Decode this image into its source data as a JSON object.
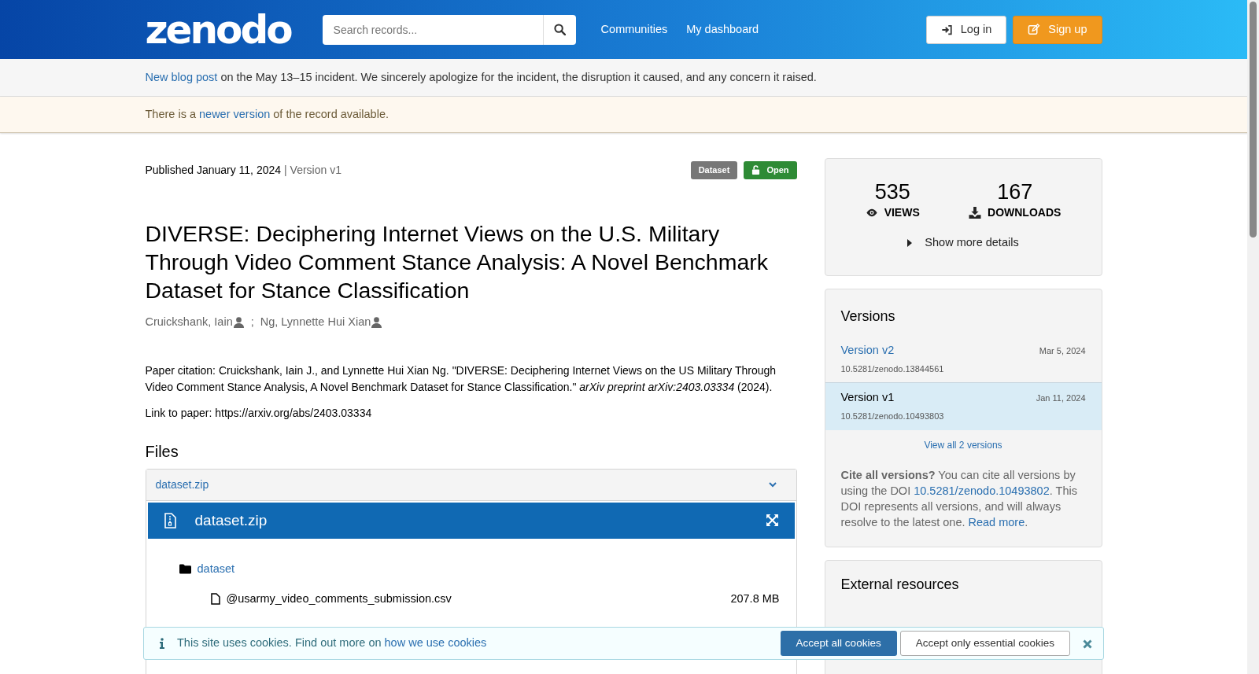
{
  "header": {
    "logo": "zenodo",
    "search": {
      "placeholder": "Search records..."
    },
    "nav": [
      "Communities",
      "My dashboard"
    ],
    "login": "Log in",
    "signup": "Sign up"
  },
  "notices": [
    {
      "kind": "blog",
      "parts": [
        {
          "kind": "link",
          "text": "New blog post"
        },
        {
          "kind": "text",
          "text": " on the May 13–15 incident. We sincerely apologize for the incident, the disruption it caused, and any concern it raised."
        }
      ]
    },
    {
      "kind": "warning",
      "parts": [
        {
          "kind": "text",
          "text": "There is a "
        },
        {
          "kind": "link",
          "text": "newer version"
        },
        {
          "kind": "text",
          "text": " of the record available."
        }
      ]
    }
  ],
  "record": {
    "published": "Published January 11, 2024",
    "version": "| Version v1",
    "badges": [
      {
        "kind": "type",
        "label": "Dataset"
      },
      {
        "kind": "access",
        "label": "Open"
      }
    ],
    "title": "DIVERSE: Deciphering Internet Views on the U.S. Military Through Video Comment Stance Analysis: A Novel Benchmark Dataset for Stance Classification",
    "creators": [
      "Cruickshank, Iain",
      "Ng, Lynnette Hui Xian"
    ],
    "creator_separator": ";",
    "description": [
      "Paper citation: Cruickshank, Iain J., and Lynnette Hui Xian Ng. \"DIVERSE: Deciphering Internet Views on the US Military Through Video Comment Stance Analysis, A Novel Benchmark Dataset for Stance Classification.\" *arXiv preprint arXiv:2403.03334* (2024).",
      "Link to paper: https://arxiv.org/abs/2403.03334"
    ]
  },
  "files": {
    "heading": "Files",
    "accordion": {
      "label": "dataset.zip",
      "expanded": true
    },
    "preview_title": "dataset.zip",
    "tree": [
      {
        "kind": "folder",
        "name": "dataset",
        "children": [
          {
            "kind": "file",
            "name": "@usarmy_video_comments_submission.csv",
            "size": "207.8 MB"
          }
        ]
      }
    ]
  },
  "stats": {
    "views": "535",
    "views_label": "VIEWS",
    "downloads": "167",
    "downloads_label": "DOWNLOADS",
    "more": "Show more details"
  },
  "versions": {
    "title": "Versions",
    "items": [
      {
        "label": "Version v2",
        "date": "Mar 5, 2024",
        "doi": "10.5281/zenodo.13844561",
        "selected": false
      },
      {
        "label": "Version v1",
        "date": "Jan 11, 2024",
        "doi": "10.5281/zenodo.10493803",
        "selected": true
      }
    ],
    "view_all": "View all 2 versions",
    "cite": [
      {
        "kind": "bold",
        "text": "Cite all versions?"
      },
      {
        "kind": "text",
        "text": " You can cite all versions by using the DOI "
      },
      {
        "kind": "link",
        "text": "10.5281/zenodo.10493802"
      },
      {
        "kind": "text",
        "text": ". This DOI represents all versions, and will always resolve to the latest one. "
      },
      {
        "kind": "link",
        "text": "Read more"
      },
      {
        "kind": "text",
        "text": "."
      }
    ]
  },
  "external": {
    "title": "External resources"
  },
  "cookie_banner": {
    "text": "This site uses cookies. Find out more on ",
    "link": "how we use cookies",
    "accept_all": "Accept all cookies",
    "accept_essential": "Accept only essential cookies"
  }
}
